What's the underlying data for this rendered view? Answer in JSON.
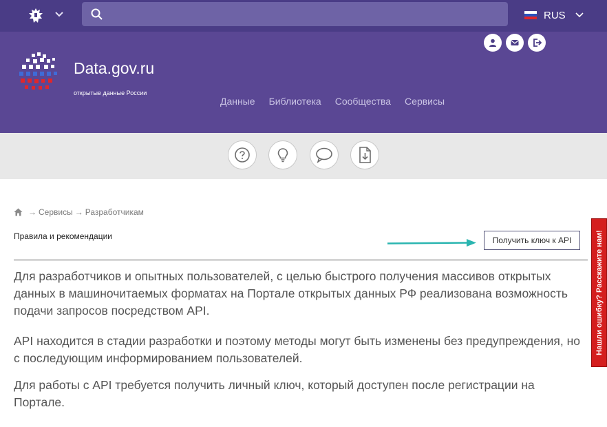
{
  "topbar": {
    "emblem_icon": "emblem-icon",
    "search": {
      "placeholder": "",
      "value": ""
    },
    "language": {
      "label": "RUS",
      "flag_colors": [
        "#ffffff",
        "#2a52be",
        "#e0262b"
      ]
    }
  },
  "header": {
    "site_title": "Data.gov.ru",
    "site_subtitle": "открытые данные России",
    "user_icons": [
      "user-icon",
      "mail-icon",
      "logout-icon"
    ],
    "nav": [
      "Данные",
      "Библиотека",
      "Сообщества",
      "Сервисы"
    ]
  },
  "icon_band": [
    "question-icon",
    "lightbulb-icon",
    "chat-icon",
    "download-doc-icon"
  ],
  "breadcrumb": {
    "arrow": "→",
    "items": [
      "Сервисы",
      "Разработчикам"
    ]
  },
  "section": {
    "label": "Правила и рекомендации",
    "api_button": "Получить ключ к API"
  },
  "content": {
    "paragraphs": [
      "Для разработчиков и опытных пользователей, с целью быстрого получения массивов открытых данных в машиночитаемых форматах на Портале открытых данных РФ реализована возможность подачи запросов посредством API.",
      "API находится в стадии разработки и поэтому методы могут быть изменены без предупреждения, но с последующим информированием пользователей.",
      "Для работы с API требуется получить личный ключ, который доступен после регистрации на Портале."
    ]
  },
  "feedback_tab": "Нашли ошибку? Расскажите нам!",
  "colors": {
    "topbar": "#4a3c86",
    "header": "#5a4794",
    "accent_arrow": "#2ab5b0",
    "feedback": "#d41e1e"
  }
}
